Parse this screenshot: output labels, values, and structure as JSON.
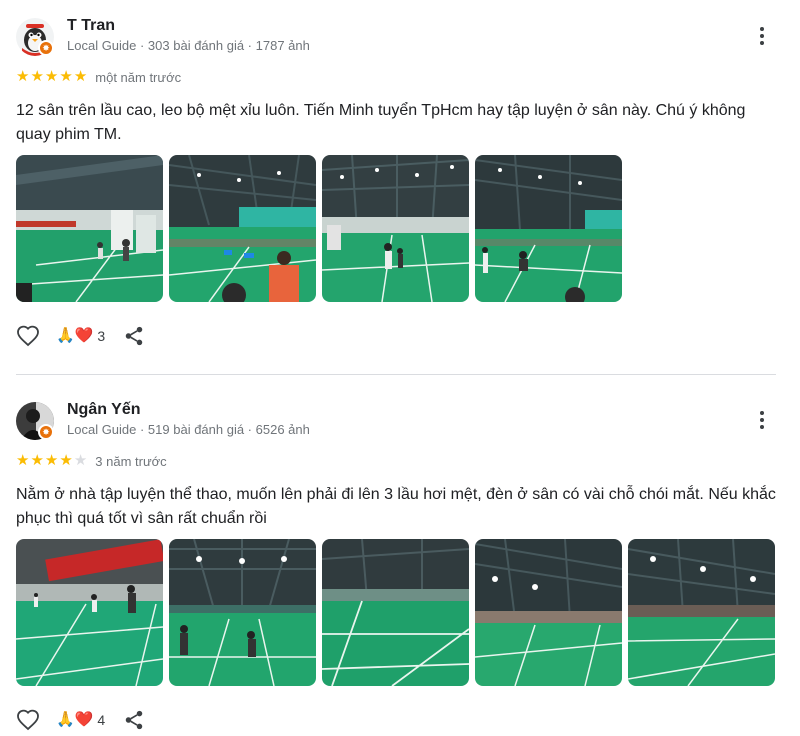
{
  "reviews": [
    {
      "name": "T Tran",
      "meta": "Local Guide · 303 bài đánh giá · 1787 ảnh",
      "rating": 5,
      "date": "một năm trước",
      "text": "12 sân trên lầu cao, leo bộ mệt xỉu luôn. Tiến Minh tuyển TpHcm hay tập luyện ở sân này. Chú ý không quay phim TM.",
      "photo_count": 4,
      "reactions_emoji": "🙏❤️",
      "reactions_count": "3"
    },
    {
      "name": "Ngân Yến",
      "meta": "Local Guide · 519 bài đánh giá · 6526 ảnh",
      "rating": 4,
      "date": "3 năm trước",
      "text": "Nằm ở nhà tập luyện thể thao, muốn lên phải đi lên 3 lầu hơi mệt, đèn ở sân có vài chỗ chói mắt. Nếu khắc phục thì quá tốt vì sân rất chuẩn rồi",
      "photo_count": 5,
      "reactions_emoji": "🙏❤️",
      "reactions_count": "4"
    }
  ],
  "icons": {
    "more": "more-vert-icon",
    "like": "heart-outline-icon",
    "share": "share-icon",
    "badge": "local-guide-star-icon"
  },
  "colors": {
    "star": "#fbbc04",
    "star_empty": "#dadce0",
    "court": "#1f9e6c",
    "badge": "#e8710a"
  }
}
